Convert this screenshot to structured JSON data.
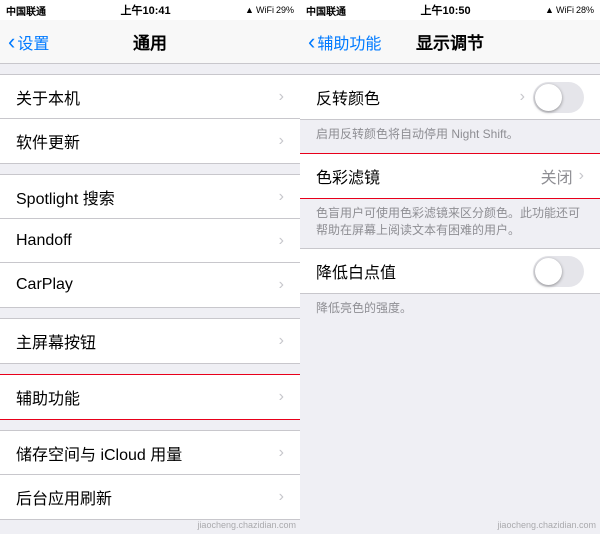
{
  "leftPanel": {
    "statusBar": {
      "carrier": "中国联通",
      "time": "上午10:41",
      "battery": "29%"
    },
    "navBar": {
      "backLabel": "设置",
      "title": "通用"
    },
    "items": [
      {
        "id": "about",
        "label": "关于本机",
        "hasChevron": true
      },
      {
        "id": "software-update",
        "label": "软件更新",
        "hasChevron": true
      },
      {
        "id": "spotlight",
        "label": "Spotlight 搜索",
        "hasChevron": true
      },
      {
        "id": "handoff",
        "label": "Handoff",
        "hasChevron": true
      },
      {
        "id": "carplay",
        "label": "CarPlay",
        "hasChevron": true
      },
      {
        "id": "home-button",
        "label": "主屏幕按钮",
        "hasChevron": true
      },
      {
        "id": "accessibility",
        "label": "辅助功能",
        "hasChevron": true,
        "highlighted": true
      },
      {
        "id": "storage",
        "label": "储存空间与 iCloud 用量",
        "hasChevron": true
      },
      {
        "id": "background-refresh",
        "label": "后台应用刷新",
        "hasChevron": true
      }
    ]
  },
  "rightPanel": {
    "statusBar": {
      "carrier": "中国联通",
      "time": "上午10:50",
      "battery": "28%"
    },
    "navBar": {
      "backLabel": "辅助功能",
      "title": "显示调节"
    },
    "sections": [
      {
        "items": [
          {
            "id": "invert-colors",
            "label": "反转颜色",
            "hasToggle": true,
            "toggleOn": false,
            "hasChevron": true
          }
        ],
        "desc": "启用反转颜色将自动停用 Night Shift。"
      },
      {
        "items": [
          {
            "id": "color-filter",
            "label": "色彩滤镜",
            "value": "关闭",
            "hasChevron": true,
            "highlighted": true
          }
        ],
        "desc": "色盲用户可使用色彩滤镜来区分颜色。此功能还可帮助在屏幕上阅读文本有困难的用户。"
      },
      {
        "items": [
          {
            "id": "reduce-white",
            "label": "降低白点值",
            "hasToggle": true,
            "toggleOn": false
          }
        ],
        "desc": "降低亮色的强度。"
      }
    ]
  },
  "watermark": "jiaocheng.chazidian.com"
}
